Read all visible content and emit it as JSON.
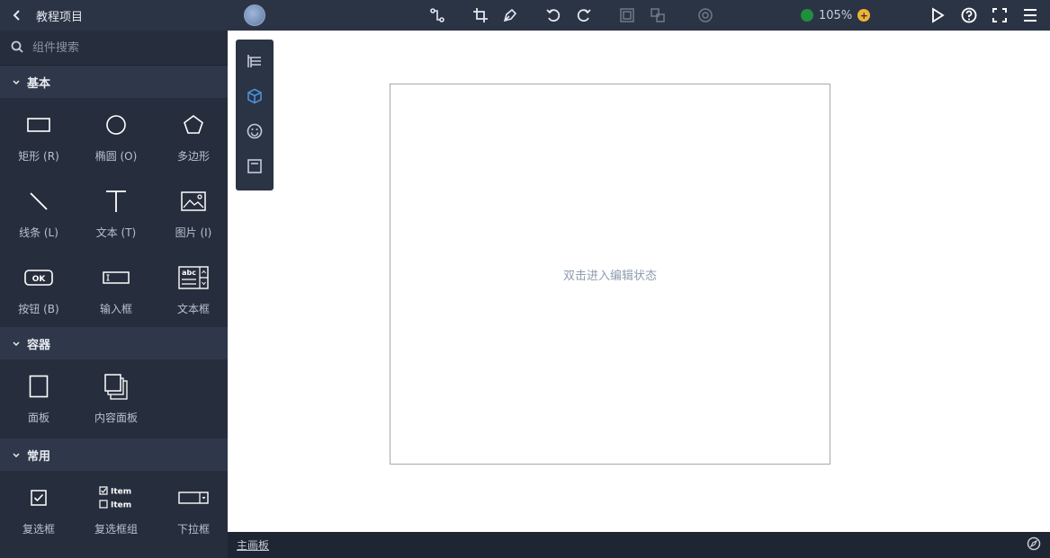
{
  "header": {
    "project_title": "教程项目",
    "zoom": "105%"
  },
  "sidebar": {
    "search_placeholder": "组件搜索",
    "sections": [
      {
        "title": "基本",
        "items": [
          {
            "label": "矩形 (R)",
            "icon": "rectangle-icon"
          },
          {
            "label": "椭圆 (O)",
            "icon": "ellipse-icon"
          },
          {
            "label": "多边形",
            "icon": "polygon-icon"
          },
          {
            "label": "线条 (L)",
            "icon": "line-icon"
          },
          {
            "label": "文本 (T)",
            "icon": "text-icon"
          },
          {
            "label": "图片 (I)",
            "icon": "image-icon"
          },
          {
            "label": "按钮 (B)",
            "icon": "button-icon",
            "icon_text": "OK"
          },
          {
            "label": "输入框",
            "icon": "input-icon"
          },
          {
            "label": "文本框",
            "icon": "textarea-icon",
            "icon_text": "abc"
          }
        ]
      },
      {
        "title": "容器",
        "items": [
          {
            "label": "面板",
            "icon": "panel-icon"
          },
          {
            "label": "内容面板",
            "icon": "content-panel-icon"
          }
        ]
      },
      {
        "title": "常用",
        "items": [
          {
            "label": "复选框",
            "icon": "checkbox-icon"
          },
          {
            "label": "复选框组",
            "icon": "checkbox-group-icon",
            "icon_text": [
              "Item",
              "Item"
            ]
          },
          {
            "label": "下拉框",
            "icon": "dropdown-icon"
          }
        ]
      }
    ]
  },
  "canvas": {
    "artboard_hint": "双击进入编辑状态"
  },
  "footer": {
    "page_tab": "主画板"
  },
  "colors": {
    "topbar": "#2b3445",
    "sidebar": "#262e3d",
    "section_header": "#2f384a",
    "accent_blue": "#4a90d9",
    "zoom_green": "#1f8f3a",
    "zoom_plus": "#f2b233"
  }
}
